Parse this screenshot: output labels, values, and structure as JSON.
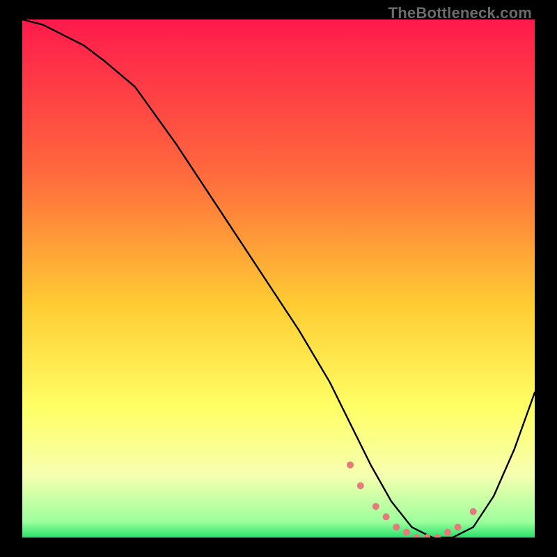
{
  "watermark": "TheBottleneck.com",
  "chart_data": {
    "type": "line",
    "title": "",
    "xlabel": "",
    "ylabel": "",
    "xlim": [
      0,
      100
    ],
    "ylim": [
      0,
      100
    ],
    "grid": false,
    "legend": false,
    "background_gradient": {
      "stops": [
        {
          "pos": 0.0,
          "color": "#ff1a4c"
        },
        {
          "pos": 0.3,
          "color": "#ff6a3d"
        },
        {
          "pos": 0.55,
          "color": "#ffcc33"
        },
        {
          "pos": 0.75,
          "color": "#ffff66"
        },
        {
          "pos": 0.88,
          "color": "#f6ffb0"
        },
        {
          "pos": 0.97,
          "color": "#9cff9c"
        },
        {
          "pos": 1.0,
          "color": "#29e06a"
        }
      ]
    },
    "series": [
      {
        "name": "bottleneck-curve",
        "color": "#000000",
        "x": [
          0,
          4,
          8,
          12,
          16,
          22,
          30,
          38,
          46,
          54,
          60,
          64,
          68,
          72,
          76,
          80,
          84,
          88,
          92,
          96,
          100
        ],
        "y": [
          100,
          99,
          97,
          95,
          92,
          87,
          76,
          64,
          52,
          40,
          30,
          22,
          14,
          7,
          2,
          0,
          0,
          2,
          8,
          17,
          28
        ]
      }
    ],
    "flat_region_markers": {
      "name": "optimal-range-dots",
      "color": "#e47a7a",
      "x": [
        64,
        66,
        69,
        71,
        73,
        75,
        77,
        79,
        81,
        83,
        85,
        88
      ],
      "y": [
        14,
        10,
        6,
        4,
        2,
        1,
        0,
        0,
        0,
        1,
        2,
        5
      ]
    }
  }
}
